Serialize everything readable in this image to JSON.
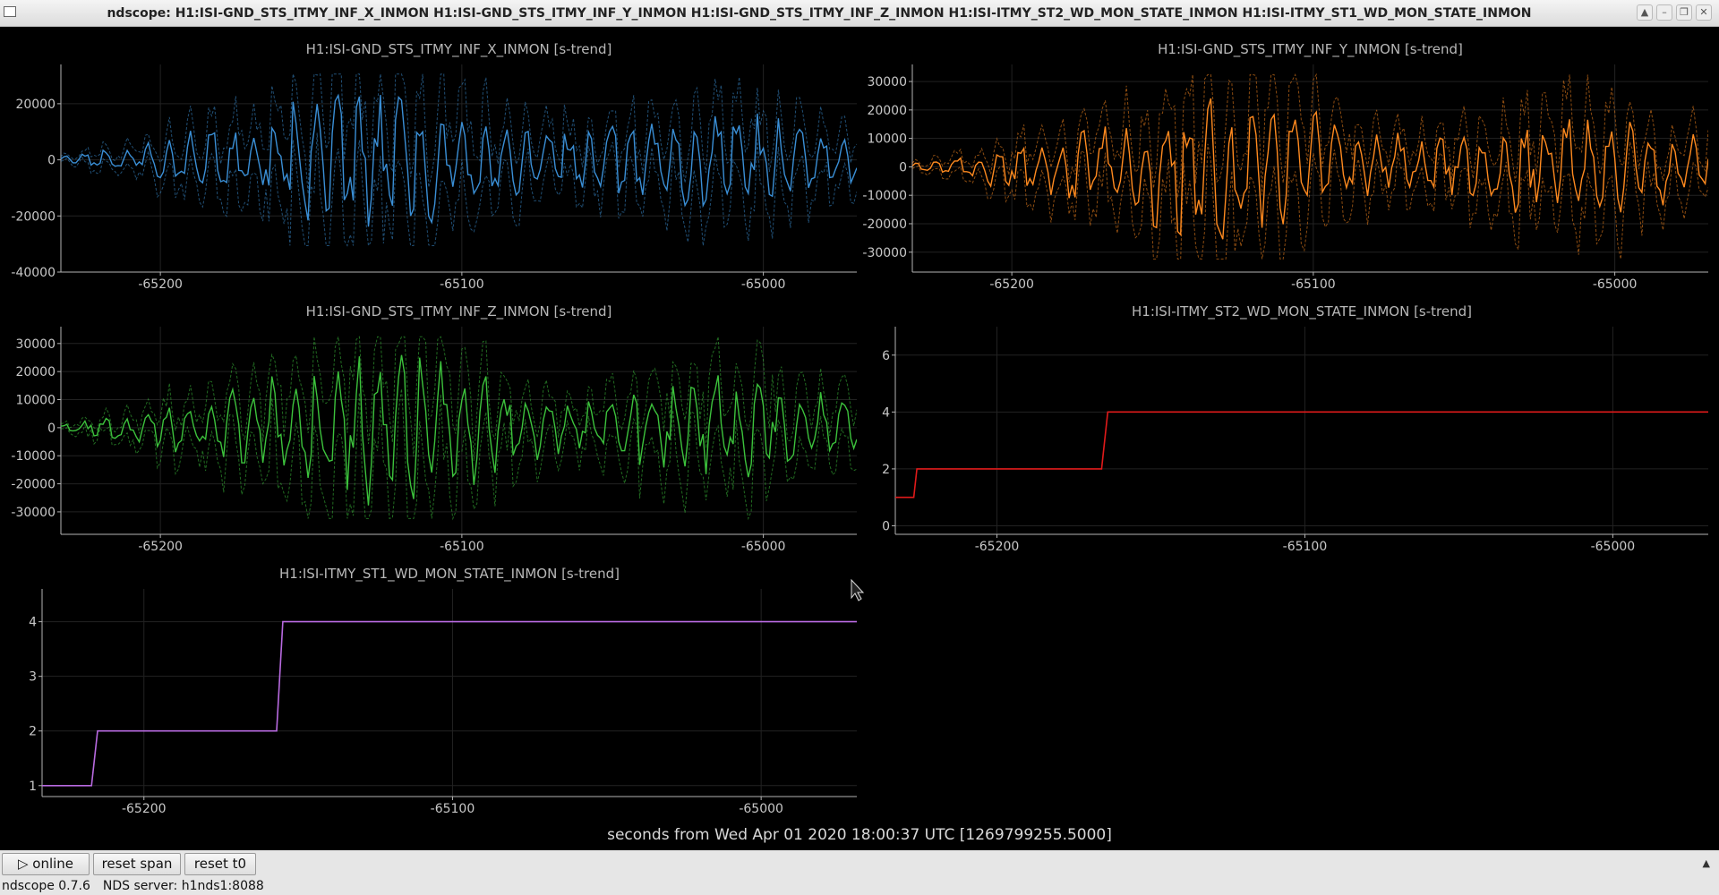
{
  "window": {
    "title": "ndscope: H1:ISI-GND_STS_ITMY_INF_X_INMON H1:ISI-GND_STS_ITMY_INF_Y_INMON H1:ISI-GND_STS_ITMY_INF_Z_INMON H1:ISI-ITMY_ST2_WD_MON_STATE_INMON H1:ISI-ITMY_ST1_WD_MON_STATE_INMON",
    "buttons": [
      "restore-up",
      "minimize",
      "maximize",
      "close"
    ]
  },
  "colors": {
    "background": "#000000",
    "axis": "#b4b4b4",
    "grid": "#222222",
    "x_series": "#3a8fd6",
    "y_series": "#ff8a1f",
    "z_series": "#3cc23c",
    "st2_series": "#e01a1a",
    "st1_series": "#b86ae0"
  },
  "xlabel": "seconds from Wed Apr 01 2020 18:00:37 UTC [1269799255.5000]",
  "chart_data": [
    {
      "type": "line",
      "title": "H1:ISI-GND_STS_ITMY_INF_X_INMON [s-trend]",
      "xlim": [
        -65233,
        -64969
      ],
      "ylim": [
        -40000,
        34000
      ],
      "xticks": [
        -65200,
        -65100,
        -65000
      ],
      "xtick_labels": [
        "-65200",
        "-65100",
        "-65000"
      ],
      "yticks": [
        -40000,
        -20000,
        0,
        20000
      ],
      "ytick_labels": [
        "-40000",
        "-20000",
        "0",
        "20000"
      ],
      "series": [
        {
          "style": "oscillating",
          "amp_min": 1500,
          "amp_max": 31000,
          "x_start": -65233,
          "x_end": -64969,
          "seed": 11,
          "min_max_band": true
        }
      ]
    },
    {
      "type": "line",
      "title": "H1:ISI-GND_STS_ITMY_INF_Y_INMON [s-trend]",
      "xlim": [
        -65233,
        -64969
      ],
      "ylim": [
        -37000,
        36000
      ],
      "xticks": [
        -65200,
        -65100,
        -65000
      ],
      "xtick_labels": [
        "-65200",
        "-65100",
        "-65000"
      ],
      "yticks": [
        -30000,
        -20000,
        -10000,
        0,
        10000,
        20000,
        30000
      ],
      "ytick_labels": [
        "-30000",
        "-20000",
        "-10000",
        "0",
        "10000",
        "20000",
        "30000"
      ],
      "series": [
        {
          "style": "oscillating",
          "amp_min": 1500,
          "amp_max": 32000,
          "x_start": -65233,
          "x_end": -64969,
          "seed": 23,
          "min_max_band": true
        }
      ]
    },
    {
      "type": "line",
      "title": "H1:ISI-GND_STS_ITMY_INF_Z_INMON [s-trend]",
      "xlim": [
        -65233,
        -64969
      ],
      "ylim": [
        -38000,
        36000
      ],
      "xticks": [
        -65200,
        -65100,
        -65000
      ],
      "xtick_labels": [
        "-65200",
        "-65100",
        "-65000"
      ],
      "yticks": [
        -30000,
        -20000,
        -10000,
        0,
        10000,
        20000,
        30000
      ],
      "ytick_labels": [
        "-30000",
        "-20000",
        "-10000",
        "0",
        "10000",
        "20000",
        "30000"
      ],
      "series": [
        {
          "style": "oscillating",
          "amp_min": 2000,
          "amp_max": 32000,
          "x_start": -65233,
          "x_end": -64969,
          "seed": 37,
          "min_max_band": true
        }
      ]
    },
    {
      "type": "line",
      "title": "H1:ISI-ITMY_ST2_WD_MON_STATE_INMON [s-trend]",
      "xlim": [
        -65233,
        -64969
      ],
      "ylim": [
        -0.3,
        7
      ],
      "xticks": [
        -65200,
        -65100,
        -65000
      ],
      "xtick_labels": [
        "-65200",
        "-65100",
        "-65000"
      ],
      "yticks": [
        0,
        2,
        4,
        6
      ],
      "ytick_labels": [
        "0",
        "2",
        "4",
        "6"
      ],
      "series": [
        {
          "style": "step",
          "x": [
            -65233,
            -65227,
            -65226,
            -65166,
            -65164,
            -64969
          ],
          "y": [
            1,
            1,
            2,
            2,
            4,
            4
          ]
        }
      ]
    },
    {
      "type": "line",
      "title": "H1:ISI-ITMY_ST1_WD_MON_STATE_INMON [s-trend]",
      "xlim": [
        -65233,
        -64969
      ],
      "ylim": [
        0.8,
        4.6
      ],
      "xticks": [
        -65200,
        -65100,
        -65000
      ],
      "xtick_labels": [
        "-65200",
        "-65100",
        "-65000"
      ],
      "yticks": [
        1,
        2,
        3,
        4
      ],
      "ytick_labels": [
        "1",
        "2",
        "3",
        "4"
      ],
      "series": [
        {
          "style": "step",
          "x": [
            -65233,
            -65217,
            -65215,
            -65157,
            -65155,
            -64969
          ],
          "y": [
            1,
            1,
            2,
            2,
            4,
            4
          ]
        }
      ]
    }
  ],
  "controls": {
    "online": "▷ online",
    "reset_span": "reset span",
    "reset_t0": "reset t0"
  },
  "status": {
    "version": "ndscope 0.7.6",
    "server": "NDS server: h1nds1:8088"
  }
}
